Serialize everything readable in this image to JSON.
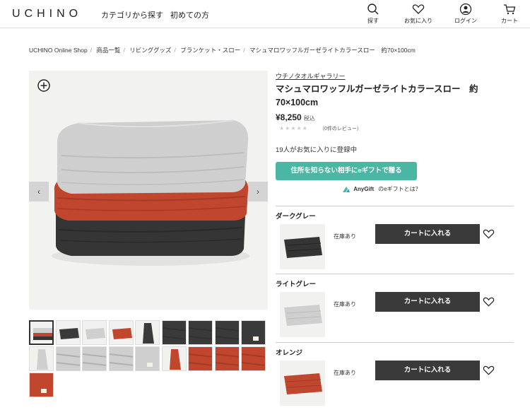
{
  "header": {
    "logo": "UCHINO",
    "nav": [
      "カテゴリから探す",
      "初めての方"
    ],
    "icons": [
      {
        "name": "search-icon",
        "label": "探す"
      },
      {
        "name": "heart-icon",
        "label": "お気に入り"
      },
      {
        "name": "user-icon",
        "label": "ログイン"
      },
      {
        "name": "cart-icon",
        "label": "カート"
      }
    ]
  },
  "breadcrumb": [
    "UCHINO Online Shop",
    "商品一覧",
    "リビンググッズ",
    "ブランケット・スロー",
    "マシュマロワッフルガーゼライトカラースロー　約70×100cm"
  ],
  "product": {
    "brand": "ウチノタオルギャラリー",
    "title": "マシュマロワッフルガーゼライトカラースロー　約70×100cm",
    "price": "¥8,250",
    "tax": "税込",
    "stars": "★★★★★",
    "rating": 0,
    "reviews": "（0件のレビュー）",
    "favorites": "19人がお気に入りに登録中",
    "gift_button": "住所を知らない相手にeギフトで贈る",
    "anygift_brand": "AnyGift",
    "anygift_text": "のeギフトとは？"
  },
  "variants": [
    {
      "name": "ダークグレー",
      "stock": "在庫あり",
      "cart": "カートに入れる",
      "color": "#3a3a3a"
    },
    {
      "name": "ライトグレー",
      "stock": "在庫あり",
      "cart": "カートに入れる",
      "color": "#cfcfcf"
    },
    {
      "name": "オレンジ",
      "stock": "在庫あり",
      "cart": "カートに入れる",
      "color": "#c0462e"
    }
  ],
  "thumbnails": [
    {
      "kind": "stack"
    },
    {
      "kind": "dark"
    },
    {
      "kind": "light"
    },
    {
      "kind": "orange"
    },
    {
      "kind": "dark-scarf"
    },
    {
      "kind": "dark-texture"
    },
    {
      "kind": "dark-texture2"
    },
    {
      "kind": "dark-texture3"
    },
    {
      "kind": "dark-label"
    },
    {
      "kind": "light-scarf"
    },
    {
      "kind": "light-texture"
    },
    {
      "kind": "light-texture2"
    },
    {
      "kind": "light-texture3"
    },
    {
      "kind": "light-label"
    },
    {
      "kind": "orange-scarf"
    },
    {
      "kind": "orange-texture"
    },
    {
      "kind": "orange-texture2"
    },
    {
      "kind": "orange-texture3"
    },
    {
      "kind": "orange-label"
    }
  ],
  "colors": {
    "gift": "#49b7a3",
    "cart": "#3a3a3a",
    "dark": "#3a3a3a",
    "light": "#cfcfcf",
    "orange": "#c0462e"
  }
}
